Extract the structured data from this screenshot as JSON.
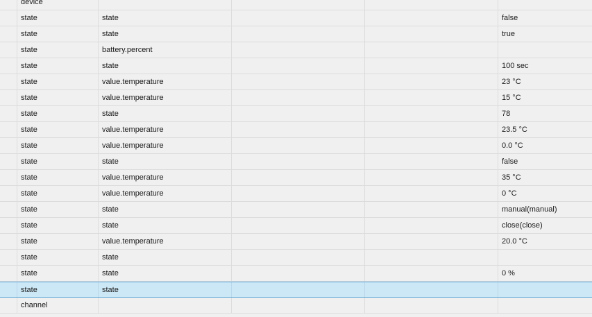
{
  "table": {
    "rows": [
      {
        "type": "device",
        "role": "",
        "value": "",
        "selected": false
      },
      {
        "type": "state",
        "role": "state",
        "value": "false",
        "selected": false
      },
      {
        "type": "state",
        "role": "state",
        "value": "true",
        "selected": false
      },
      {
        "type": "state",
        "role": "battery.percent",
        "value": "",
        "selected": false
      },
      {
        "type": "state",
        "role": "state",
        "value": "100 sec",
        "selected": false
      },
      {
        "type": "state",
        "role": "value.temperature",
        "value": "23 °C",
        "selected": false
      },
      {
        "type": "state",
        "role": "value.temperature",
        "value": "15 °C",
        "selected": false
      },
      {
        "type": "state",
        "role": "state",
        "value": "78",
        "selected": false
      },
      {
        "type": "state",
        "role": "value.temperature",
        "value": "23.5 °C",
        "selected": false
      },
      {
        "type": "state",
        "role": "value.temperature",
        "value": "0.0 °C",
        "selected": false
      },
      {
        "type": "state",
        "role": "state",
        "value": "false",
        "selected": false
      },
      {
        "type": "state",
        "role": "value.temperature",
        "value": "35 °C",
        "selected": false
      },
      {
        "type": "state",
        "role": "value.temperature",
        "value": "0 °C",
        "selected": false
      },
      {
        "type": "state",
        "role": "state",
        "value": "manual(manual)",
        "selected": false
      },
      {
        "type": "state",
        "role": "state",
        "value": "close(close)",
        "selected": false
      },
      {
        "type": "state",
        "role": "value.temperature",
        "value": "20.0 °C",
        "selected": false
      },
      {
        "type": "state",
        "role": "state",
        "value": "",
        "selected": false
      },
      {
        "type": "state",
        "role": "state",
        "value": "0 %",
        "selected": false
      },
      {
        "type": "state",
        "role": "state",
        "value": "",
        "selected": true
      },
      {
        "type": "channel",
        "role": "",
        "value": "",
        "selected": false
      }
    ]
  },
  "colors": {
    "background": "#f0f0f0",
    "grid_line": "#dcdcdc",
    "selection": "#cce8f6",
    "selection_border": "#5aa6d6"
  }
}
